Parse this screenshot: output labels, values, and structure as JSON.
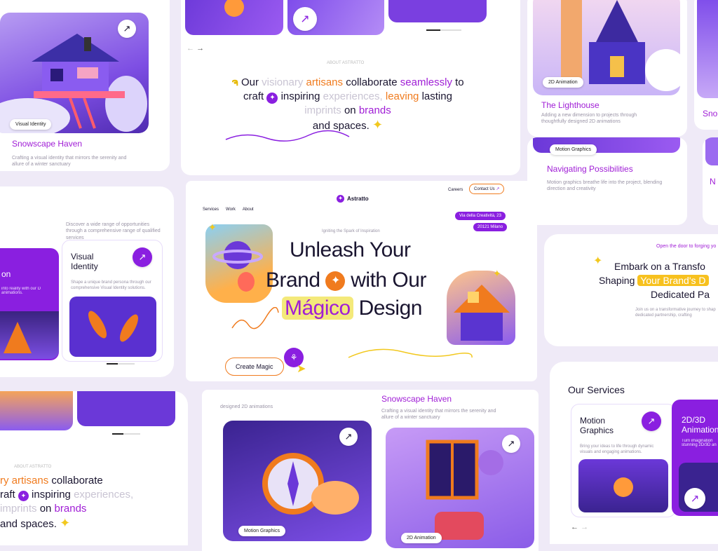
{
  "cards": {
    "snowscape_top": {
      "title": "Snowscape Haven",
      "desc": "Crafting a visual identity that mirrors the serenity and allure of a winter sanctuary",
      "tag": "Visual Identity"
    },
    "lighthouse": {
      "title": "The Lighthouse",
      "desc": "Adding a new dimension to projects through thoughtfully designed 2D animations",
      "tag": "2D Animation"
    },
    "navigating": {
      "title": "Navigating Possibilities",
      "desc": "Motion graphics breathe life into the project, blending direction and creativity",
      "tag": "Motion Graphics"
    },
    "snowscape_mid": {
      "title": "Snowscape Haven",
      "desc": "Crafting a visual identity that mirrors the serenity and allure of a winter sanctuary",
      "above": "designed 2D animations"
    },
    "compass_tag": "Motion Graphics",
    "window_tag": "2D Animation",
    "right_partial_title": "Sno",
    "right_partial_n": "N"
  },
  "about": {
    "label": "ABOUT ASTRATTO",
    "w1": "Our",
    "w2": "visionary",
    "w3": "artisans",
    "w4": "collaborate",
    "w5": "seamlessly",
    "w6": "to craft",
    "w7": "inspiring",
    "w8": "experiences,",
    "w9": "leaving",
    "w10": "lasting",
    "w11": "imprints",
    "w12": "on",
    "w13": "brands",
    "w14": "and spaces."
  },
  "about_bottom": {
    "label": "ABOUT ASTRATTO",
    "l1a": "ry",
    "l1b": "artisans",
    "l1c": "collaborate",
    "l2a": "raft",
    "l2b": "inspiring",
    "l2c": "experiences,",
    "l3a": "imprints",
    "l3b": "on",
    "l3c": "brands",
    "l4": "and spaces."
  },
  "services_left": {
    "intro": "Discover a wide range of opportunities through a comprehensive range of qualified services",
    "partial_title": "on",
    "partial_desc": "into reality with our D animations.",
    "visual_identity": "Visual Identity",
    "vi_desc": "Shape a unique brand persona through our comprehensive Visual Identity solutions."
  },
  "hero": {
    "brand": "Astratto",
    "nav": [
      "Services",
      "Work",
      "About"
    ],
    "careers": "Careers",
    "contact": "Contact Us",
    "address1": "Via della Creatività, 23",
    "address2": "20121 Milano",
    "tagline": "Igniting the Spark of Inspiration",
    "line1": "Unleash Your",
    "line2a": "Brand",
    "line2b": "with Our",
    "line3a": "Mágico",
    "line3b": "Design",
    "cta": "Create Magic"
  },
  "embark": {
    "kicker": "Open the door to forging yo",
    "l1": "Embark on a Transfo",
    "l2a": "Shaping",
    "l2b": "Your Brand's D",
    "l3": "Dedicated Pa",
    "desc": "Join us on a transformative journey to shap dedicated partnership, crafting"
  },
  "our_services": {
    "title": "Our Services",
    "motion": "Motion Graphics",
    "motion_desc": "Bring your ideas to life through dynamic visuals and engaging animations.",
    "anim": "2D/3D Animation",
    "anim_desc": "Turn imagination stunning 2D/3D an"
  },
  "colors": {
    "accent": "#8a1fe0",
    "orange": "#f07b1e",
    "yellow": "#f4e97a",
    "bg": "#efeaf7"
  }
}
